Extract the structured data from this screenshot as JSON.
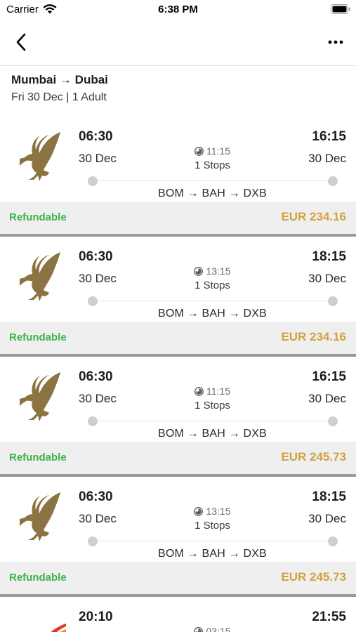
{
  "status_bar": {
    "carrier": "Carrier",
    "time": "6:38 PM"
  },
  "nav": {
    "back_icon": "chevron-left-icon",
    "more_icon": "ellipsis-icon"
  },
  "trip": {
    "route": "Mumbai → Dubai",
    "details": "Fri 30 Dec | 1 Adult"
  },
  "colors": {
    "refundable": "#3fb24c",
    "price": "#d2a13d",
    "airline_gold": "#8c7342",
    "airline_red": "#e2342a"
  },
  "flights": [
    {
      "dep_time": "06:30",
      "dep_date": "30 Dec",
      "arr_time": "16:15",
      "arr_date": "30 Dec",
      "duration": "11:15",
      "stops": "1 Stops",
      "path": "BOM → BAH → DXB",
      "refund": "Refundable",
      "price": "EUR 234.16"
    },
    {
      "dep_time": "06:30",
      "dep_date": "30 Dec",
      "arr_time": "18:15",
      "arr_date": "30 Dec",
      "duration": "13:15",
      "stops": "1 Stops",
      "path": "BOM → BAH → DXB",
      "refund": "Refundable",
      "price": "EUR 234.16"
    },
    {
      "dep_time": "06:30",
      "dep_date": "30 Dec",
      "arr_time": "16:15",
      "arr_date": "30 Dec",
      "duration": "11:15",
      "stops": "1 Stops",
      "path": "BOM → BAH → DXB",
      "refund": "Refundable",
      "price": "EUR 245.73"
    },
    {
      "dep_time": "06:30",
      "dep_date": "30 Dec",
      "arr_time": "18:15",
      "arr_date": "30 Dec",
      "duration": "13:15",
      "stops": "1 Stops",
      "path": "BOM → BAH → DXB",
      "refund": "Refundable",
      "price": "EUR 245.73"
    },
    {
      "dep_time": "20:10",
      "arr_time": "21:55",
      "duration": "03:15"
    }
  ]
}
